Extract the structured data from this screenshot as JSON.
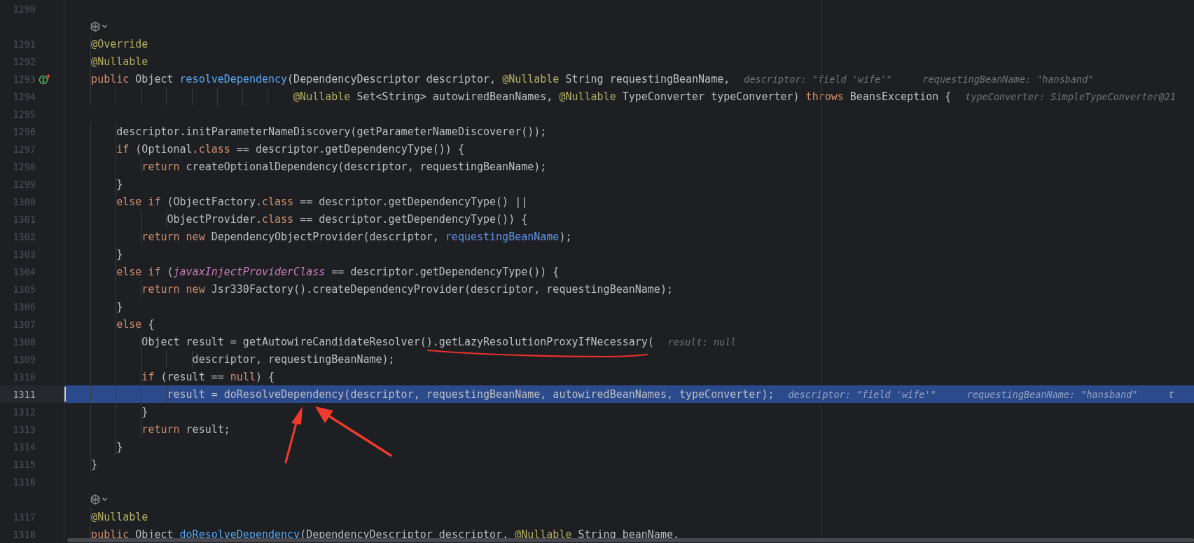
{
  "editor": {
    "lines": [
      {
        "kind": "code",
        "number": "1290",
        "current": false
      },
      {
        "kind": "code-vision"
      },
      {
        "kind": "code",
        "number": "1291",
        "current": false,
        "tokens": [
          {
            "kind": "annotation",
            "text": "    @Override"
          }
        ]
      },
      {
        "kind": "code",
        "number": "1292",
        "current": false,
        "tokens": [
          {
            "kind": "annotation",
            "text": "    @Nullable"
          }
        ]
      },
      {
        "kind": "code",
        "number": "1293",
        "current": false,
        "marker": {
          "kind": "implements"
        },
        "tokens": [
          {
            "kind": "keyword",
            "text": "    public"
          },
          {
            "kind": "plain",
            "text": " Object "
          },
          {
            "kind": "method",
            "text": "resolveDependency"
          },
          {
            "kind": "plain",
            "text": "(DependencyDescriptor descriptor, "
          },
          {
            "kind": "annotation",
            "text": "@Nullable"
          },
          {
            "kind": "plain",
            "text": " String requestingBeanName,"
          }
        ],
        "hints": [
          "descriptor: \"field 'wife'\"",
          "requestingBeanName: \"hansband\""
        ]
      },
      {
        "kind": "code",
        "number": "1294",
        "current": false,
        "tokens": [
          {
            "kind": "annotation",
            "text": "                                    @Nullable"
          },
          {
            "kind": "plain",
            "text": " Set<String> autowiredBeanNames, "
          },
          {
            "kind": "annotation",
            "text": "@Nullable"
          },
          {
            "kind": "plain",
            "text": " TypeConverter typeConverter) "
          },
          {
            "kind": "keyword",
            "text": "throws"
          },
          {
            "kind": "plain",
            "text": " BeansException {"
          }
        ],
        "hints": [
          "typeConverter: SimpleTypeConverter@21"
        ]
      },
      {
        "kind": "code",
        "number": "1295",
        "current": false
      },
      {
        "kind": "code",
        "number": "1296",
        "current": false,
        "tokens": [
          {
            "kind": "plain",
            "text": "        descriptor.initParameterNameDiscovery(getParameterNameDiscoverer());"
          }
        ]
      },
      {
        "kind": "code",
        "number": "1297",
        "current": false,
        "tokens": [
          {
            "kind": "keyword",
            "text": "        if"
          },
          {
            "kind": "plain",
            "text": " (Optional."
          },
          {
            "kind": "keyword",
            "text": "class"
          },
          {
            "kind": "plain",
            "text": " == descriptor.getDependencyType()) {"
          }
        ]
      },
      {
        "kind": "code",
        "number": "1298",
        "current": false,
        "tokens": [
          {
            "kind": "keyword",
            "text": "            return"
          },
          {
            "kind": "plain",
            "text": " createOptionalDependency(descriptor, requestingBeanName);"
          }
        ]
      },
      {
        "kind": "code",
        "number": "1299",
        "current": false,
        "tokens": [
          {
            "kind": "plain",
            "text": "        }"
          }
        ]
      },
      {
        "kind": "code",
        "number": "1300",
        "current": false,
        "tokens": [
          {
            "kind": "keyword",
            "text": "        else if"
          },
          {
            "kind": "plain",
            "text": " (ObjectFactory."
          },
          {
            "kind": "keyword",
            "text": "class"
          },
          {
            "kind": "plain",
            "text": " == descriptor.getDependencyType() ||"
          }
        ]
      },
      {
        "kind": "code",
        "number": "1301",
        "current": false,
        "tokens": [
          {
            "kind": "plain",
            "text": "                ObjectProvider."
          },
          {
            "kind": "keyword",
            "text": "class"
          },
          {
            "kind": "plain",
            "text": " == descriptor.getDependencyType()) {"
          }
        ]
      },
      {
        "kind": "code",
        "number": "1302",
        "current": false,
        "tokens": [
          {
            "kind": "keyword",
            "text": "            return new"
          },
          {
            "kind": "plain",
            "text": " DependencyObjectProvider(descriptor, "
          },
          {
            "kind": "param",
            "text": "requestingBeanName"
          },
          {
            "kind": "plain",
            "text": ");"
          }
        ]
      },
      {
        "kind": "code",
        "number": "1303",
        "current": false,
        "tokens": [
          {
            "kind": "plain",
            "text": "        }"
          }
        ]
      },
      {
        "kind": "code",
        "number": "1304",
        "current": false,
        "tokens": [
          {
            "kind": "keyword",
            "text": "        else if"
          },
          {
            "kind": "plain",
            "text": " ("
          },
          {
            "kind": "field",
            "text": "javaxInjectProviderClass"
          },
          {
            "kind": "plain",
            "text": " == descriptor.getDependencyType()) {"
          }
        ]
      },
      {
        "kind": "code",
        "number": "1305",
        "current": false,
        "tokens": [
          {
            "kind": "keyword",
            "text": "            return new"
          },
          {
            "kind": "plain",
            "text": " Jsr330Factory().createDependencyProvider(descriptor, requestingBeanName);"
          }
        ]
      },
      {
        "kind": "code",
        "number": "1306",
        "current": false,
        "tokens": [
          {
            "kind": "plain",
            "text": "        }"
          }
        ]
      },
      {
        "kind": "code",
        "number": "1307",
        "current": false,
        "tokens": [
          {
            "kind": "keyword",
            "text": "        else"
          },
          {
            "kind": "plain",
            "text": " {"
          }
        ]
      },
      {
        "kind": "code",
        "number": "1308",
        "current": false,
        "tokens": [
          {
            "kind": "plain",
            "text": "            Object result = getAutowireCandidateResolver().getLazyResolutionProxyIfNecessary("
          }
        ],
        "hints": [
          "result: null"
        ]
      },
      {
        "kind": "code",
        "number": "1309",
        "current": false,
        "tokens": [
          {
            "kind": "plain",
            "text": "                    descriptor, requestingBeanName);"
          }
        ]
      },
      {
        "kind": "code",
        "number": "1310",
        "current": false,
        "tokens": [
          {
            "kind": "keyword",
            "text": "            if"
          },
          {
            "kind": "plain",
            "text": " (result == "
          },
          {
            "kind": "keyword",
            "text": "null"
          },
          {
            "kind": "plain",
            "text": ") {"
          }
        ]
      },
      {
        "kind": "code",
        "number": "1311",
        "current": true,
        "tokens": [
          {
            "kind": "plain",
            "text": "                result = doResolveDependency(descriptor, requestingBeanName, autowiredBeanNames, typeConverter);"
          }
        ],
        "hints": [
          "descriptor: \"field 'wife'\"",
          "requestingBeanName: \"hansband\"",
          "t"
        ]
      },
      {
        "kind": "code",
        "number": "1312",
        "current": false,
        "tokens": [
          {
            "kind": "plain",
            "text": "            }"
          }
        ]
      },
      {
        "kind": "code",
        "number": "1313",
        "current": false,
        "tokens": [
          {
            "kind": "keyword",
            "text": "            return"
          },
          {
            "kind": "plain",
            "text": " result;"
          }
        ]
      },
      {
        "kind": "code",
        "number": "1314",
        "current": false,
        "tokens": [
          {
            "kind": "plain",
            "text": "        }"
          }
        ]
      },
      {
        "kind": "code",
        "number": "1315",
        "current": false,
        "tokens": [
          {
            "kind": "plain",
            "text": "    }"
          }
        ]
      },
      {
        "kind": "code",
        "number": "1316",
        "current": false
      },
      {
        "kind": "code-vision"
      },
      {
        "kind": "code",
        "number": "1317",
        "current": false,
        "tokens": [
          {
            "kind": "annotation",
            "text": "    @Nullable"
          }
        ]
      },
      {
        "kind": "code",
        "number": "1318",
        "current": false,
        "tokens": [
          {
            "kind": "keyword",
            "text": "    public"
          },
          {
            "kind": "plain",
            "text": " Object "
          },
          {
            "kind": "method",
            "text": "doResolveDependency"
          },
          {
            "kind": "plain",
            "text": "(DependencyDescriptor descriptor, "
          },
          {
            "kind": "annotation",
            "text": "@Nullable"
          },
          {
            "kind": "plain",
            "text": " String beanName,"
          }
        ]
      }
    ]
  }
}
